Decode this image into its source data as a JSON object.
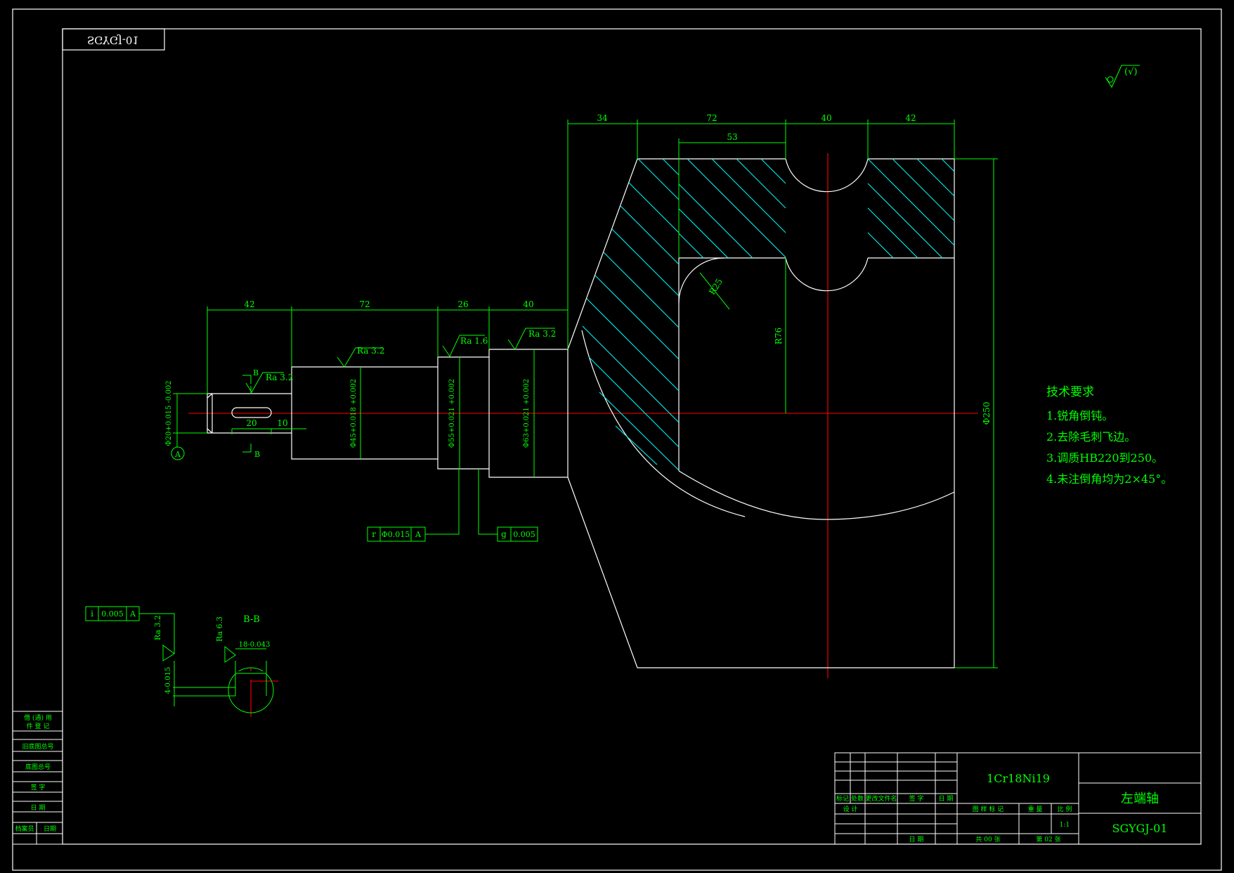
{
  "drawing": {
    "background": "#000000",
    "colors": {
      "frame": "#ffffff",
      "dimension": "#00ff00",
      "hatch": "#00ffff",
      "centerline": "#ff0000",
      "text": "#00ff00"
    },
    "mirrored_code": "SGYGJ-01",
    "general_roughness": "(√)"
  },
  "shaft": {
    "dimensions": [
      "42",
      "72",
      "26",
      "40"
    ],
    "diameters": [
      "Φ20+0.015 -0.002",
      "Φ45+0.018 +0.002",
      "Φ55+0.021 +0.002",
      "Φ63+0.021 +0.002"
    ],
    "roughness": [
      "Ra 3.2",
      "Ra 3.2",
      "Ra 1.6",
      "Ra 3.2"
    ],
    "keyway_dims": [
      "20",
      "10"
    ],
    "section_mark": "B",
    "datum": "A"
  },
  "crank": {
    "dimensions": [
      "34",
      "72",
      "40",
      "42",
      "53"
    ],
    "radius_small": "R25",
    "radius_large": "R76",
    "diameter": "Φ250"
  },
  "tolerances": {
    "runout": {
      "symbol": "r",
      "value": "Φ0.015",
      "datum": "A"
    },
    "cylindricity": {
      "symbol": "g",
      "value": "0.005"
    },
    "symmetry": {
      "symbol": "i",
      "value": "0.005",
      "datum": "A"
    }
  },
  "section": {
    "title": "B-B",
    "roughness_1": "Ra 3.2",
    "roughness_2": "Ra 6.3",
    "width_dim": "18-0.043",
    "depth_dim": "4-0.015"
  },
  "tech_requirements": {
    "title": "技术要求",
    "items": [
      "1.锐角倒钝。",
      "2.去除毛刺飞边。",
      "3.调质HB220到250。",
      "4.未注倒角均为2×45°。"
    ]
  },
  "title_block": {
    "material": "1Cr18Ni19",
    "part_name": "左端轴",
    "drawing_number": "SGYGJ-01",
    "scale_label": "比 例",
    "scale_value": "1:1",
    "weight_label": "重 量",
    "stage_label": "图 样 标 记",
    "total_sheets": "共 00 张",
    "sheet_number": "第 02 张",
    "change_labels": [
      "标记",
      "处数",
      "更改文件名",
      "签 字",
      "日 期"
    ],
    "design_label": "设 计",
    "date_label": "日 期"
  },
  "side_block": {
    "labels": [
      "借 (通) 用",
      "件 登 记",
      "旧底图总号",
      "底图总号",
      "签 字",
      "日 期",
      "档案员",
      "日期"
    ]
  }
}
